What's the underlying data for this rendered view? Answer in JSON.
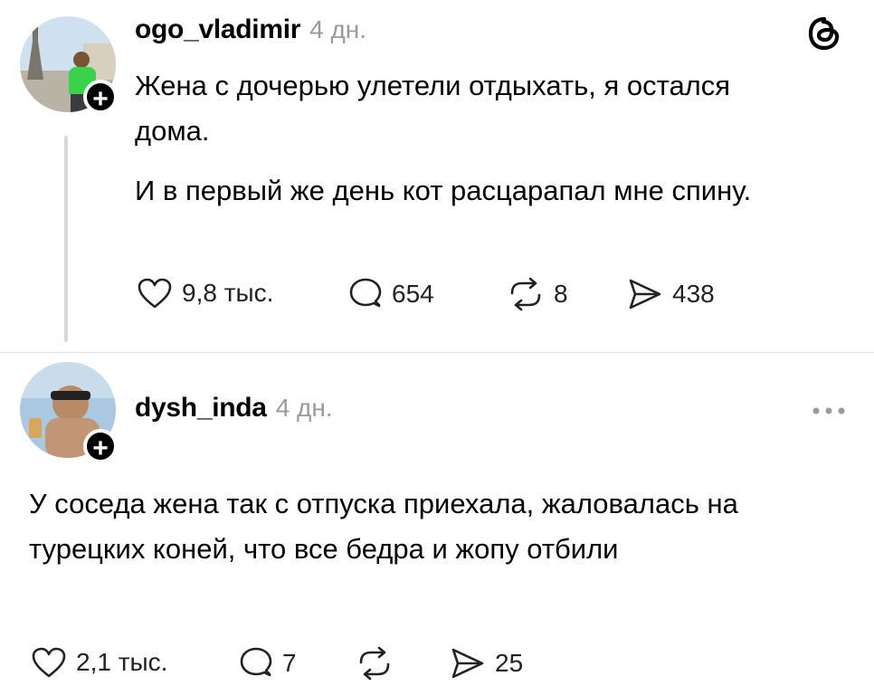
{
  "posts": [
    {
      "username": "ogo_vladimir",
      "time": "4 дн.",
      "paragraphs": [
        "Жена с дочерью улетели отдыхать, я остался дома.",
        "И в первый же день кот расцарапал мне спину."
      ],
      "stats": {
        "likes": "9,8 тыс.",
        "comments": "654",
        "reposts": "8",
        "shares": "438"
      }
    },
    {
      "username": "dysh_inda",
      "time": "4 дн.",
      "text": "У соседа жена так с отпуска приехала, жаловалась на турецких коней, что все бедра и жопу отбили",
      "stats": {
        "likes": "2,1 тыс.",
        "comments": "7",
        "shares": "25"
      }
    }
  ],
  "colors": {
    "text": "#000000",
    "muted": "#9a9a9a",
    "divider": "#dcdcdc"
  },
  "icons": [
    "threads-logo-icon",
    "more-options-icon",
    "heart-icon",
    "comment-icon",
    "repost-icon",
    "share-icon",
    "follow-plus-icon"
  ]
}
